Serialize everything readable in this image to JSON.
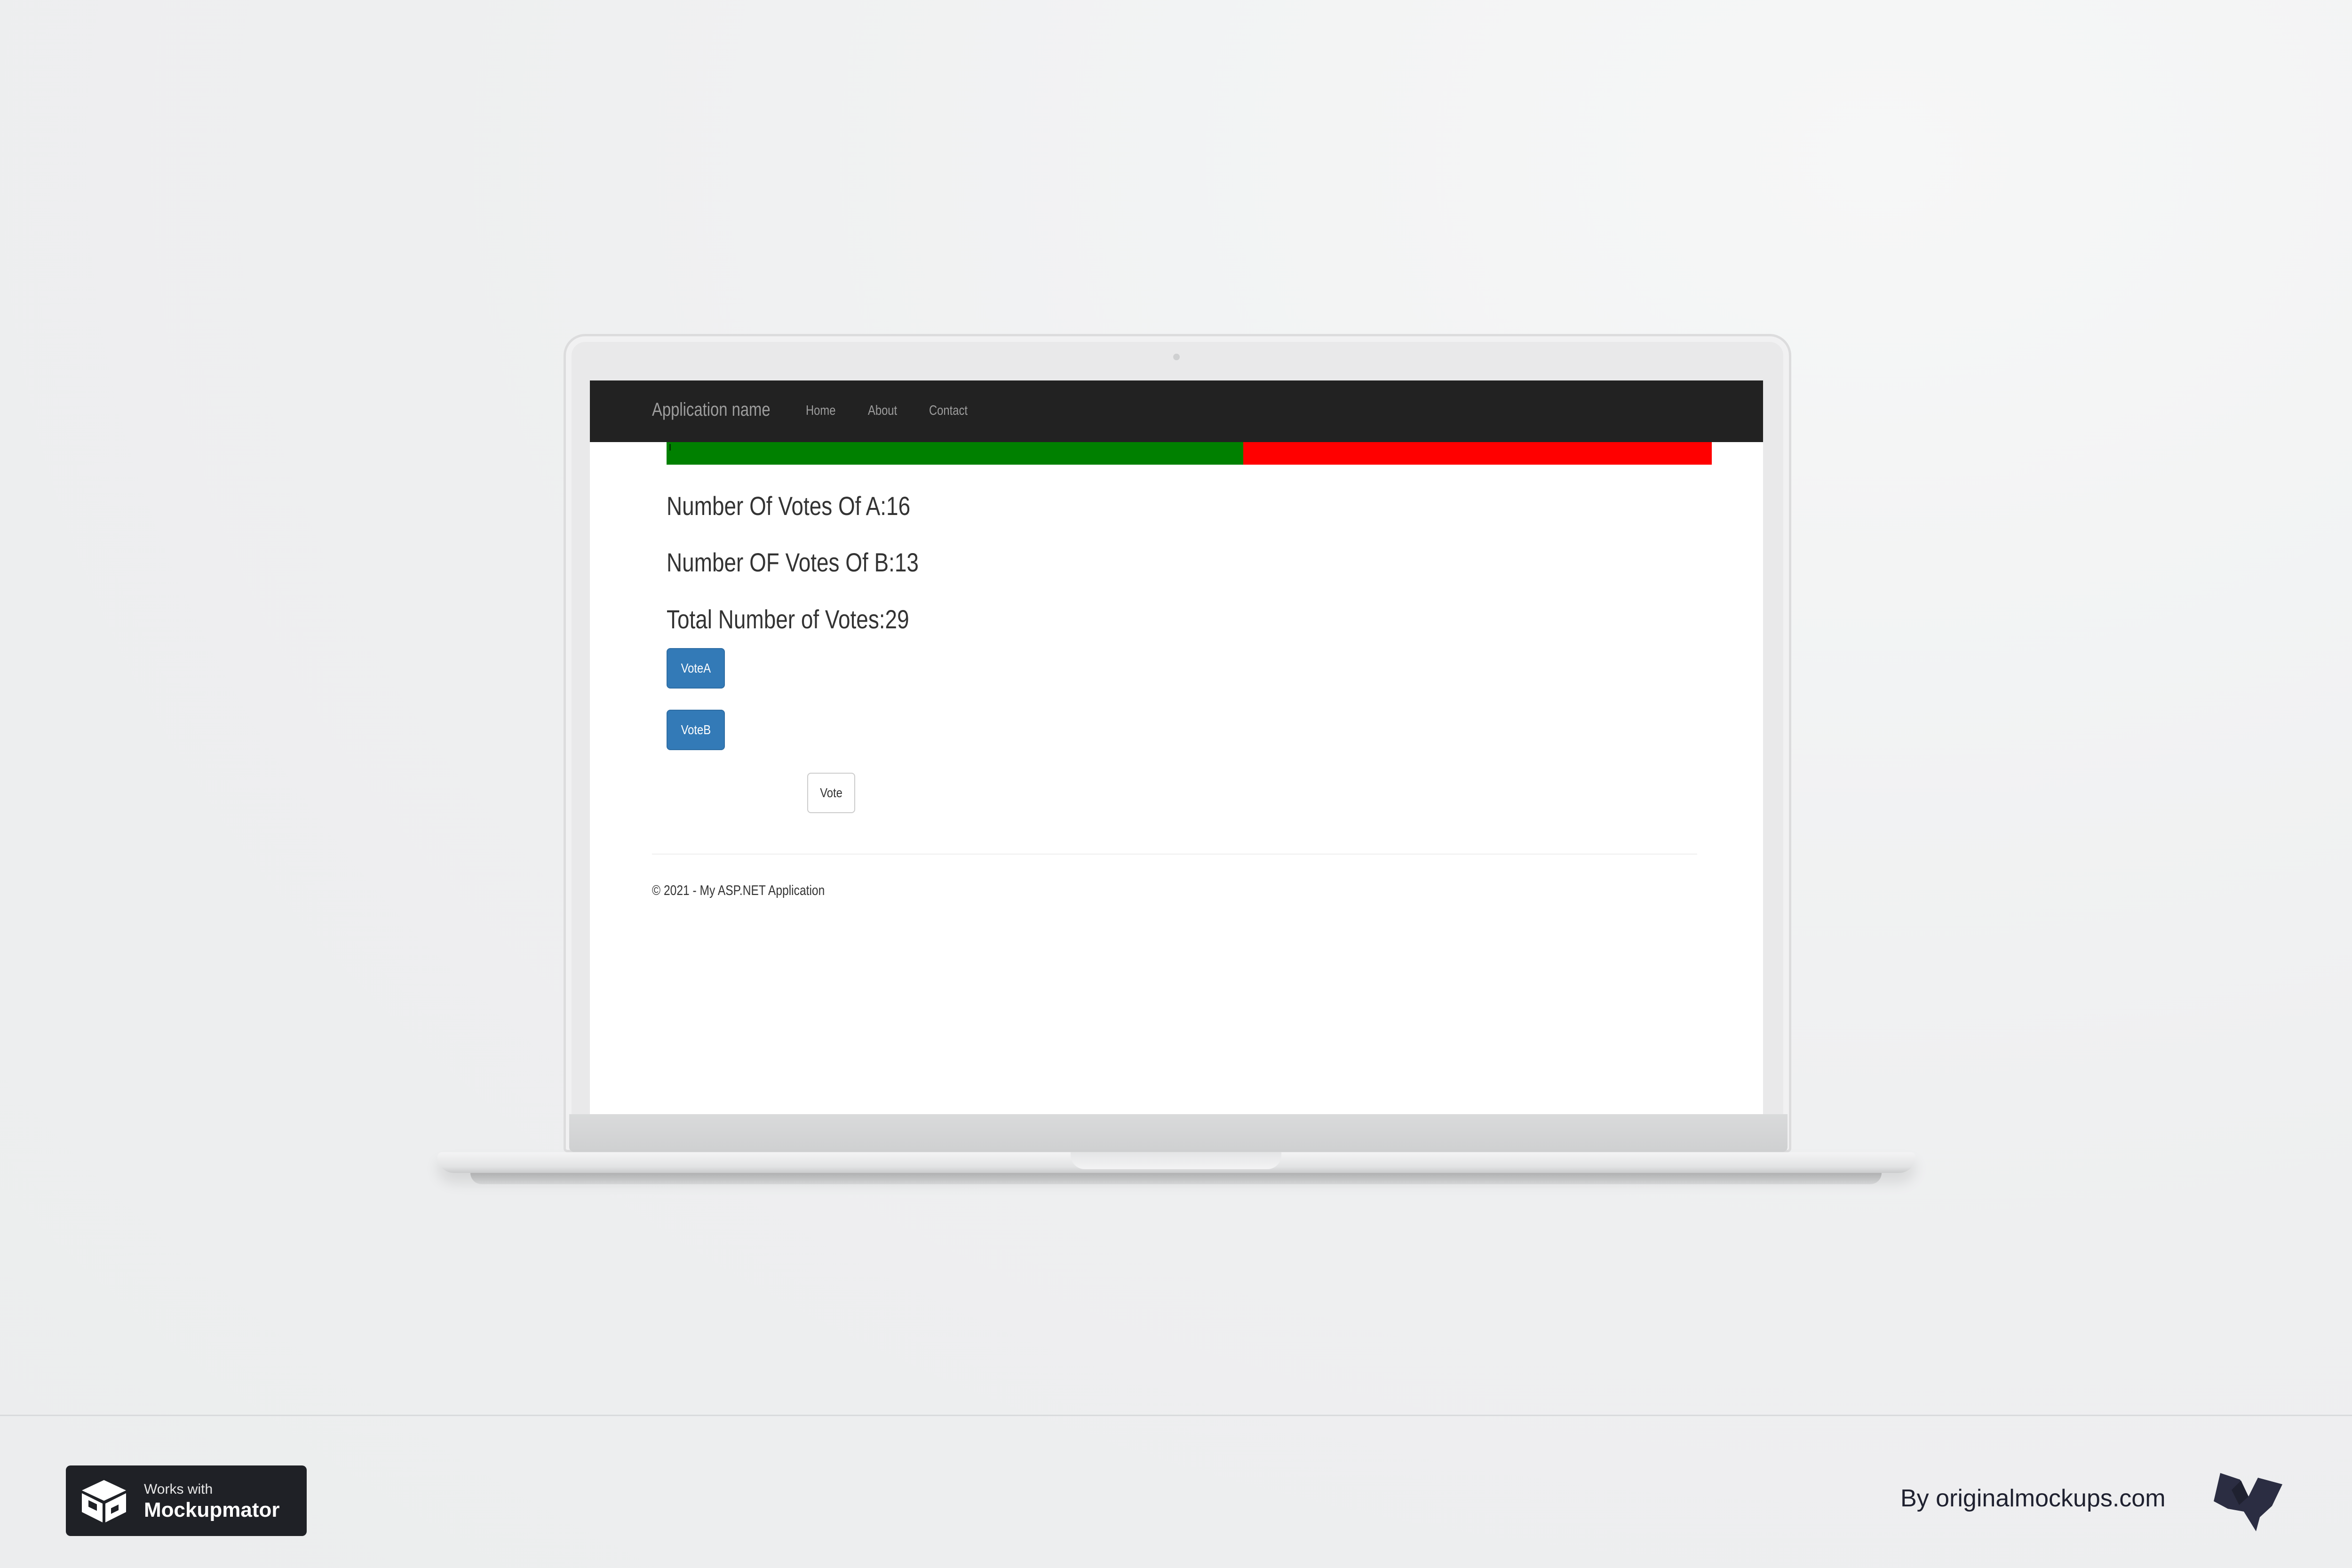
{
  "navbar": {
    "brand": "Application name",
    "links": [
      "Home",
      "About",
      "Contact"
    ]
  },
  "vote_bar": {
    "votes_a": 16,
    "votes_b": 13,
    "color_a": "#008000",
    "color_b": "#ff0000"
  },
  "stats": {
    "votes_a_text": "Number Of Votes Of A:16",
    "votes_b_text": "Number OF Votes Of B:13",
    "total_text": "Total Number of Votes:29"
  },
  "buttons": {
    "vote_a": "VoteA",
    "vote_b": "VoteB",
    "vote": "Vote"
  },
  "footer": {
    "copyright": "© 2021 - My ASP.NET Application"
  },
  "badge": {
    "small": "Works with",
    "big": "Mockupmator"
  },
  "credit": {
    "text": "By originalmockups.com"
  },
  "colors": {
    "navbar_bg": "#222222",
    "primary_button": "#337ab7"
  }
}
